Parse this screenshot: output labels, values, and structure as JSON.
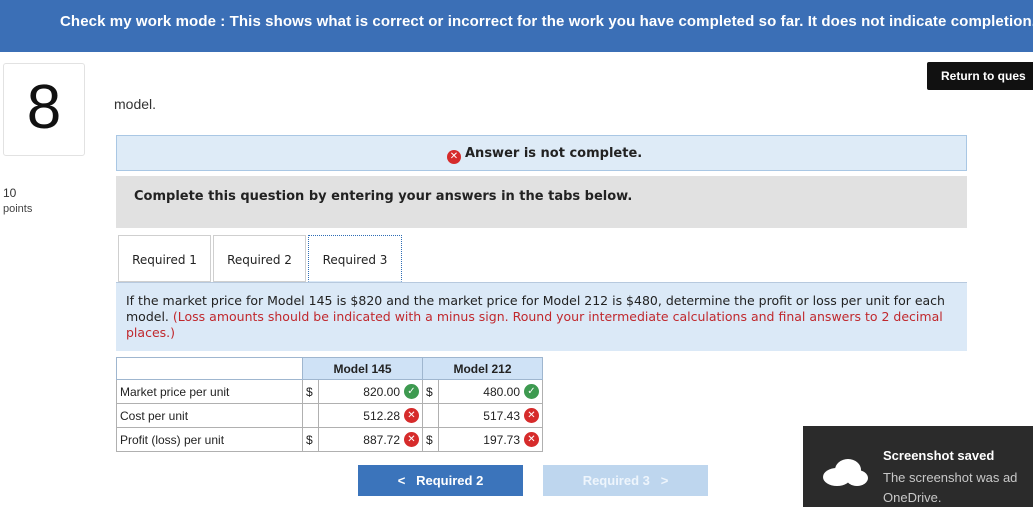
{
  "banner": {
    "text": "Check my work mode : This shows what is correct or incorrect for the work you have completed so far. It does not indicate completion."
  },
  "question": {
    "number": "8",
    "points_value": "10",
    "points_label": "points",
    "text": "model."
  },
  "return_button": {
    "label": "Return to ques"
  },
  "notice": {
    "text": "Answer is not complete."
  },
  "instruction": {
    "text": "Complete this question by entering your answers in the tabs below."
  },
  "tabs": [
    {
      "label": "Required 1"
    },
    {
      "label": "Required 2"
    },
    {
      "label": "Required 3",
      "active": true
    }
  ],
  "prompt": {
    "text": "If the market price for Model 145 is $820 and the market price for Model 212 is $480, determine the profit or loss per unit for each model.",
    "note": "(Loss amounts should be indicated with a minus sign. Round your intermediate calculations and final answers to 2 decimal places.)"
  },
  "table": {
    "headers": [
      "Model 145",
      "Model 212"
    ],
    "rows": [
      {
        "label": "Market price per unit",
        "m145_dollar": "$",
        "m145": "820.00",
        "m145_status": "correct",
        "m212_dollar": "$",
        "m212": "480.00",
        "m212_status": "correct"
      },
      {
        "label": "Cost per unit",
        "m145_dollar": "",
        "m145": "512.28",
        "m145_status": "incorrect",
        "m212_dollar": "",
        "m212": "517.43",
        "m212_status": "incorrect"
      },
      {
        "label": "Profit (loss) per unit",
        "m145_dollar": "$",
        "m145": "887.72",
        "m145_status": "incorrect",
        "m212_dollar": "$",
        "m212": "197.73",
        "m212_status": "incorrect"
      }
    ]
  },
  "nav": {
    "prev_label": "Required 2",
    "next_label": "Required 3",
    "prev_arrow": "<",
    "next_arrow": ">"
  },
  "toast": {
    "title": "Screenshot saved",
    "message": "The screenshot was ad OneDrive.",
    "line1": "The screenshot was ad",
    "line2": "OneDrive."
  },
  "icons": {
    "check": "✓",
    "cross": "✕"
  },
  "colors": {
    "banner": "#3b6fb6",
    "correct": "#3e9a50",
    "incorrect": "#d62b2b",
    "primary_button": "#3b74bb"
  }
}
